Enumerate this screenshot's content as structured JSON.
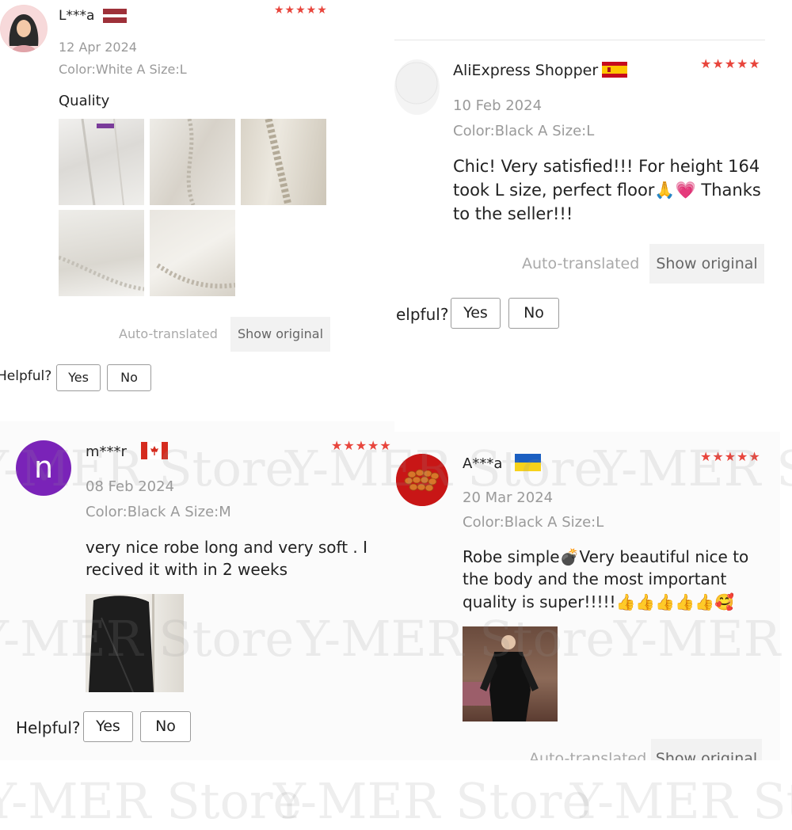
{
  "watermark": "Y-MER Store",
  "rating_glyphs": "★★★★★",
  "colors": {
    "star_red": "#e8453c",
    "meta_gray": "#9a9a9a",
    "purple_avatar": "#7a23b8"
  },
  "reviews": [
    {
      "name": "L***a",
      "flag": "latvia-flag",
      "rating": 5,
      "date": "12 Apr 2024",
      "variant": "Color:White A Size:L",
      "text": "Quality",
      "photos": [
        "white-robe-photo-1",
        "white-robe-photo-2",
        "white-robe-lace-photo",
        "white-robe-sleeve-photo",
        "white-robe-hem-photo"
      ],
      "auto_translated": "Auto-translated",
      "show_original": "Show original",
      "helpful": "Helpful?",
      "yes": "Yes",
      "no": "No"
    },
    {
      "name": "AliExpress Shopper",
      "flag": "spain-flag",
      "rating": 5,
      "date": "10 Feb 2024",
      "variant": "Color:Black A Size:L",
      "text": "Chic! Very satisfied!!! For height 164 took L size, perfect floor🙏💗 Thanks to the seller!!!",
      "auto_translated": "Auto-translated",
      "show_original": "Show original",
      "helpful": "elpful?",
      "yes": "Yes",
      "no": "No"
    },
    {
      "name": "m***r",
      "avatar_letter": "n",
      "flag": "canada-flag",
      "rating": 5,
      "date": "08 Feb 2024",
      "variant": "Color:Black A Size:M",
      "text": "very nice robe long and very soft . I recived it with in 2 weeks",
      "photos": [
        "black-robe-photo"
      ],
      "helpful": "Helpful?",
      "yes": "Yes",
      "no": "No"
    },
    {
      "name": "A***a",
      "flag": "ukraine-flag",
      "rating": 5,
      "date": "20 Mar 2024",
      "variant": "Color:Black A Size:L",
      "text": "Robe simple💣Very beautiful nice to the body and the most important quality is super!!!!!👍👍👍👍👍🥰",
      "photos": [
        "woman-black-robe-photo"
      ],
      "auto_translated": "Auto-translated",
      "show_original": "Show original"
    }
  ]
}
